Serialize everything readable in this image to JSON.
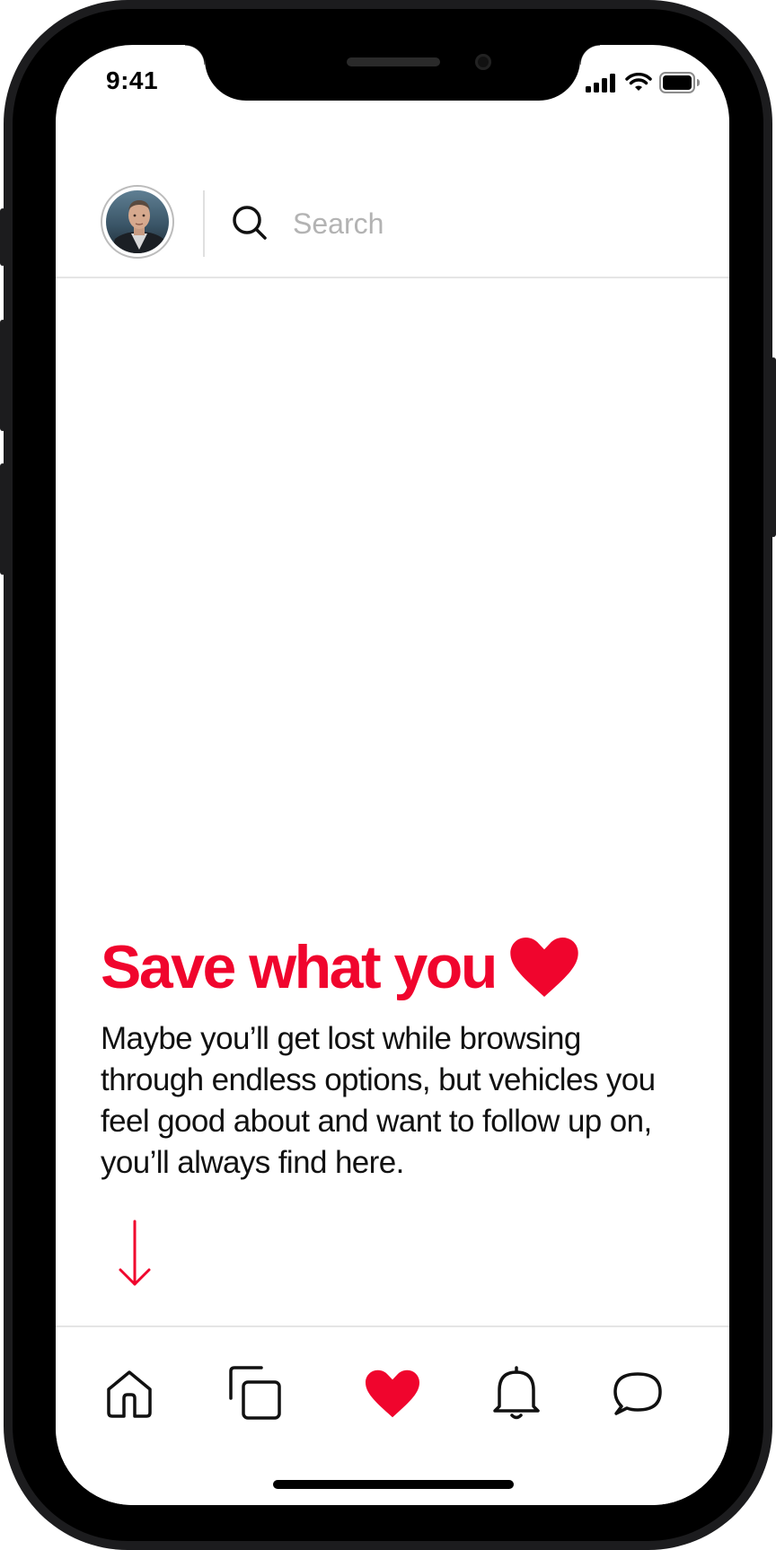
{
  "status_bar": {
    "time": "9:41",
    "icons": [
      "cellular-signal-icon",
      "wifi-icon",
      "battery-icon"
    ]
  },
  "header": {
    "avatar_icon": "profile-avatar",
    "search": {
      "placeholder": "Search",
      "value": ""
    },
    "search_icon": "search-icon"
  },
  "hero": {
    "title": "Save what you",
    "title_icon": "heart-icon",
    "body": "Maybe you’ll get lost while browsing through endless options, but vehicles you feel good about and want to follow up on, you’ll always find here.",
    "scroll_icon": "arrow-down-icon"
  },
  "tabbar": {
    "items": [
      {
        "icon": "home-icon",
        "active": false
      },
      {
        "icon": "collections-icon",
        "active": false
      },
      {
        "icon": "heart-icon",
        "active": true
      },
      {
        "icon": "bell-icon",
        "active": false
      },
      {
        "icon": "chat-bubble-icon",
        "active": false
      }
    ]
  },
  "colors": {
    "accent": "#f0052d",
    "text": "#111111",
    "placeholder": "#b3b3b3",
    "divider": "#e5e5e5",
    "frame": "#1c1c1e"
  }
}
